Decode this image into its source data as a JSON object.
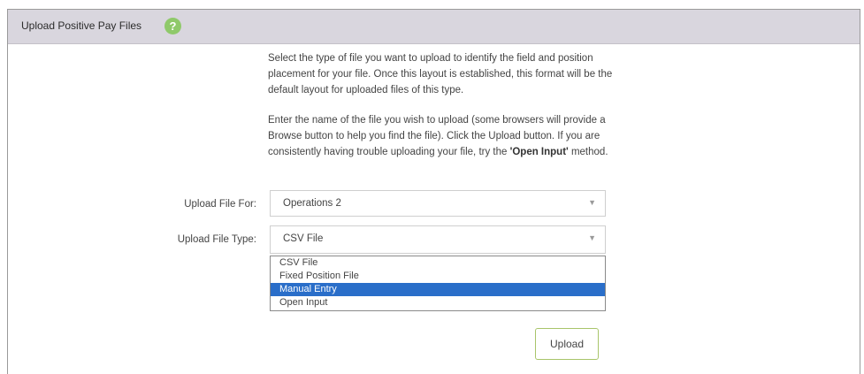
{
  "header": {
    "title": "Upload Positive Pay Files",
    "help_glyph": "?"
  },
  "instructions": {
    "para1": "Select the type of file you want to upload to identify the field and position placement for your file. Once this layout is established, this format will be the default layout for uploaded files of this type.",
    "para2_start": "Enter the name of the file you wish to upload (some browsers will provide a Browse button to help you find the file). Click the Upload button. If you are consistently having trouble uploading your file, try the ",
    "para2_bold": "'Open Input'",
    "para2_end": " method."
  },
  "form": {
    "upload_for_label": "Upload File For:",
    "upload_for_value": "Operations 2",
    "upload_type_label": "Upload File Type:",
    "upload_type_value": "CSV File",
    "upload_type_options": [
      "CSV File",
      "Fixed Position File",
      "Manual Entry",
      "Open Input"
    ],
    "highlighted_option": "Manual Entry",
    "upload_label": "Upload"
  },
  "icons": {
    "help": "help-icon",
    "dropdown_arrow": "chevron-down-icon"
  },
  "colors": {
    "header_bg": "#d9d6de",
    "help_icon": "#8fc96a",
    "selection": "#2a6ec9",
    "upload_border": "#a8c46a"
  }
}
